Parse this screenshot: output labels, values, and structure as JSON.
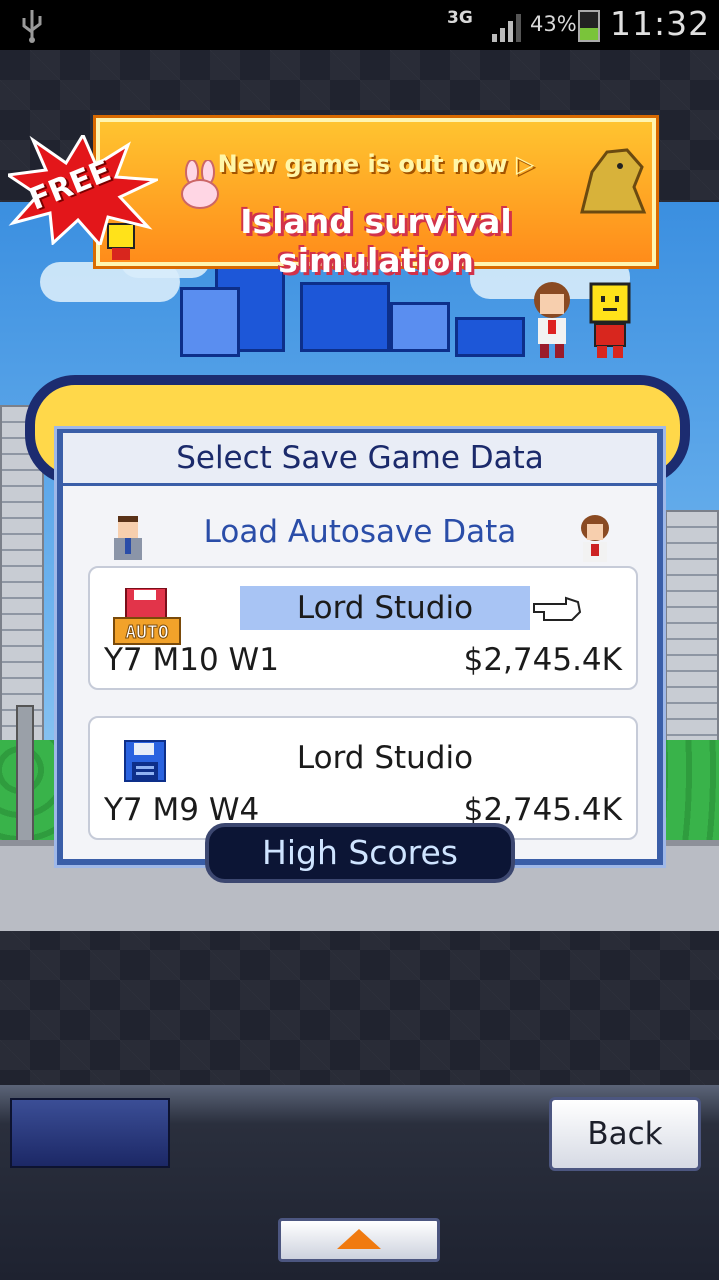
{
  "statusbar": {
    "network": "3G",
    "battery_percent": "43%",
    "battery_level": 0.43,
    "time": "11:32",
    "icons": [
      "usb-icon",
      "signal-icon",
      "battery-charging-icon"
    ]
  },
  "ad_banner": {
    "badge": "FREE",
    "line1": "New game is out now ▷",
    "line2": "Island survival simulation"
  },
  "dialog": {
    "title": "Select Save Game Data",
    "load_autosave": "Load Autosave Data",
    "slots": [
      {
        "icon": "auto-save-icon",
        "badge": "AUTO",
        "name": "Lord Studio",
        "date": "Y7 M10 W1",
        "money": "$2,745.4K",
        "selected": true
      },
      {
        "icon": "floppy-disk-icon",
        "name": "Lord Studio",
        "date": "Y7 M9 W4",
        "money": "$2,745.4K",
        "selected": false
      }
    ]
  },
  "high_scores_label": "High Scores",
  "bottom": {
    "back_label": "Back"
  },
  "colors": {
    "dialog_frame": "#3a5ea8",
    "selection": "#a8c4f4",
    "title_text": "#1b2a6b",
    "accent_text": "#2a4da8"
  }
}
